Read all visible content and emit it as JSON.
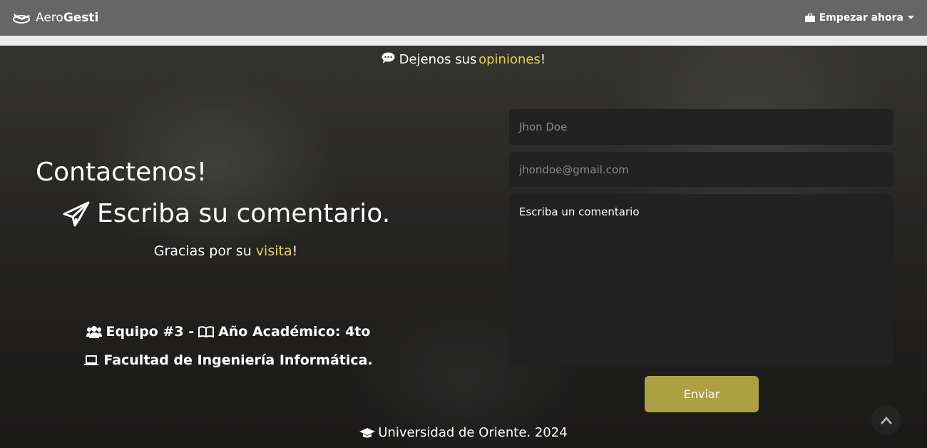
{
  "navbar": {
    "brand_part1": "Aero",
    "brand_part2": "Gesti",
    "menu_label": "Empezar ahora",
    "background": "#666666"
  },
  "hero": {
    "top_message_prefix": "Dejenos sus",
    "top_message_highlight": "opiniones",
    "top_message_suffix": "!",
    "title": "Contactenos!",
    "subtitle": "Escriba su comentario.",
    "thanks_prefix": "Gracias por su",
    "thanks_highlight": "visita",
    "thanks_suffix": "!",
    "team_text": "Equipo #3 -",
    "year_text": "Año Académico: 4to",
    "faculty_text": "Facultad de Ingeniería Informática."
  },
  "form": {
    "name_placeholder": "Jhon Doe",
    "email_placeholder": "jhondoe@gmail.com",
    "comment_text": "Escriba un comentario",
    "submit_label": "Enviar"
  },
  "footer": {
    "text": "Universidad de Oriente. 2024"
  },
  "colors": {
    "accent_yellow": "#e8d34a",
    "button": "#ada043",
    "field_bg": "#212121"
  }
}
